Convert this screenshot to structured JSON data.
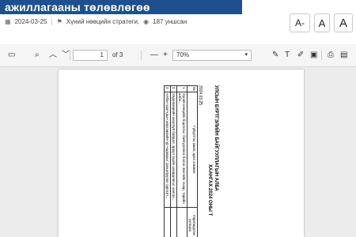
{
  "header": {
    "title": "ажиллагааны төлөвлөгөө",
    "date": "2024-03-25",
    "category": "Хүний нөөцийн стратеги,",
    "views": "187 уншсан",
    "font_small": "A-",
    "font_normal": "A",
    "font_large": "A"
  },
  "viewer": {
    "page": "1",
    "of_pages": "of 3",
    "zoom": "70%"
  },
  "doc": {
    "heading1": "УЛСЫН БҮРТГЭЛИЙН БАЙГУУЛЛАГЫН АЛБА",
    "heading2": "ХААНГАХ 2024 ОНЫ Т",
    "date": "2024.03.25",
    "col_no": "№",
    "col_action": "Гүйцэтгэх ажил, арга хэмжээ",
    "col_result": "Хэрэгжүүлэх хугацаа",
    "rows": [
      {
        "no": "1",
        "text": "Хүний нөөцийн бодлогыг байгууллага болон Засгийн газар, төрийн алба..."
      },
      {
        "no": "2",
        "text": "Хөдөлмөрийн аюулгүй байдал, эрүүл ахуйн шаардлагыг хангах..."
      },
      {
        "no": "3",
        "text": "Албан хаагчдын мэргэжлийн ур чадварыг дээшлүүлэх сургалт..."
      }
    ]
  }
}
